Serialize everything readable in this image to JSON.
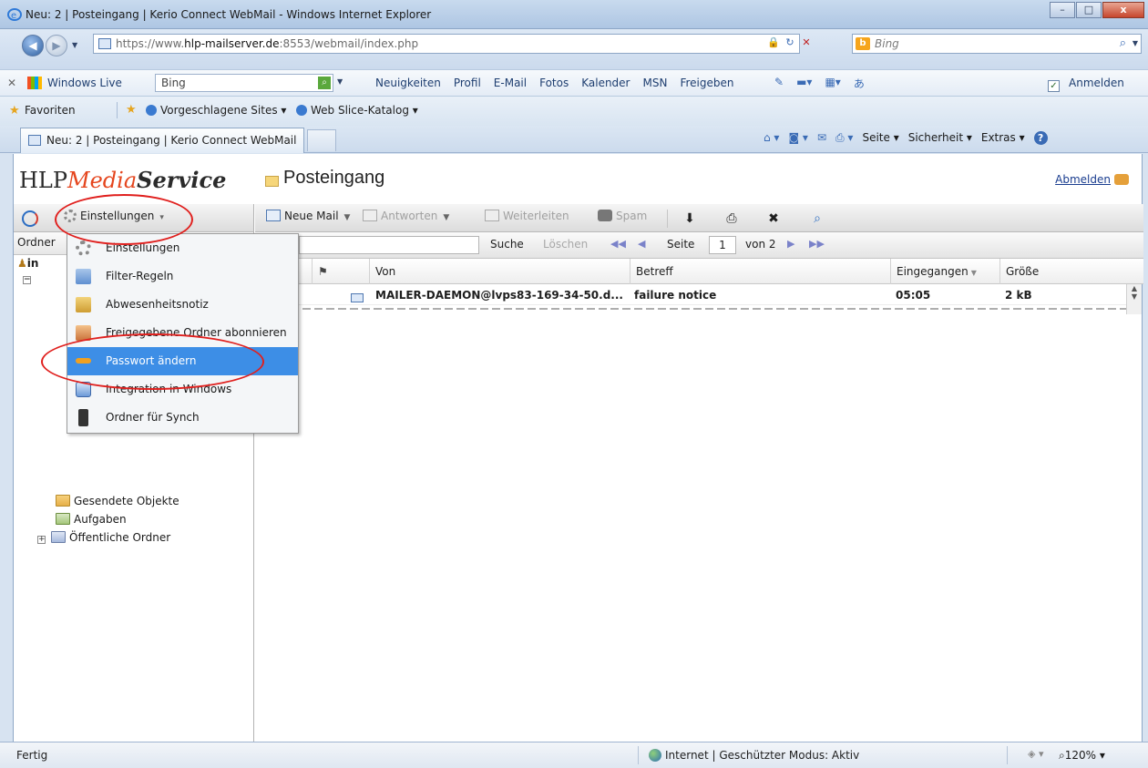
{
  "window": {
    "title": "Neu: 2 | Posteingang | Kerio Connect WebMail - Windows Internet Explorer",
    "controls": [
      "–",
      "□",
      "x"
    ]
  },
  "address_bar": {
    "url_prefix": "https://www.",
    "url_domain": "hlp-mailserver.de",
    "url_rest": ":8553/webmail/index.php",
    "search_placeholder": "Bing"
  },
  "live_toolbar": {
    "brand": "Windows Live",
    "search_value": "Bing",
    "links": [
      "Neuigkeiten",
      "Profil",
      "E-Mail",
      "Fotos",
      "Kalender",
      "MSN",
      "Freigeben"
    ],
    "signin": "Anmelden"
  },
  "favorites_bar": {
    "label": "Favoriten",
    "items": [
      "Vorgeschlagene Sites ▾",
      "Web Slice-Katalog ▾"
    ]
  },
  "tabs": [
    {
      "label": "Neu: 2 | Posteingang | Kerio Connect WebMail"
    }
  ],
  "command_bar": {
    "items": [
      "Seite ▾",
      "Sicherheit ▾",
      "Extras ▾"
    ]
  },
  "app": {
    "brand_hlp": "HLP",
    "brand_media": "Media",
    "brand_service": "Service",
    "folder_title": "Posteingang",
    "logout": "Abmelden"
  },
  "left_toolbar": {
    "settings_label": "Einstellungen"
  },
  "folder_pane": {
    "header": "Ordner",
    "user_fragment": "in",
    "items": [
      {
        "label": "Gesendete Objekte",
        "icon": "sent-folder-icon"
      },
      {
        "label": "Aufgaben",
        "icon": "tasks-folder-icon"
      },
      {
        "label": "Öffentliche Ordner",
        "icon": "public-folder-icon"
      }
    ]
  },
  "main_toolbar": {
    "new_mail": "Neue Mail",
    "reply": "Antworten",
    "forward": "Weiterleiten",
    "spam": "Spam"
  },
  "search_row": {
    "search_button": "Suche",
    "clear_button": "Löschen",
    "page_label": "Seite",
    "page_value": "1",
    "page_total": "von 2"
  },
  "message_list": {
    "columns": [
      "Von",
      "Betreff",
      "Eingegangen",
      "Größe"
    ],
    "rows": [
      {
        "from": "MAILER-DAEMON@lvps83-169-34-50.d...",
        "subject": "failure notice",
        "received": "05:05",
        "size": "2 kB"
      }
    ]
  },
  "settings_menu": {
    "items": [
      {
        "label": "Einstellungen",
        "icon": "gear-icon"
      },
      {
        "label": "Filter-Regeln",
        "icon": "filter-icon"
      },
      {
        "label": "Abwesenheitsnotiz",
        "icon": "absence-icon"
      },
      {
        "label": "Freigegebene Ordner abonnieren",
        "icon": "shared-folder-icon"
      },
      {
        "label": "Passwort ändern",
        "icon": "key-icon"
      },
      {
        "label": "Integration in Windows",
        "icon": "windows-integration-icon"
      },
      {
        "label": "Ordner für Synch",
        "icon": "mobile-phone-icon"
      }
    ],
    "active_index": 4
  },
  "status_bar": {
    "status": "Fertig",
    "zone": "Internet | Geschützter Modus: Aktiv",
    "zoom": "120%"
  },
  "colors": {
    "menu_highlight": "#3d8ee6",
    "annotation_circle": "#e0201e",
    "brand_media": "#e5461e"
  }
}
